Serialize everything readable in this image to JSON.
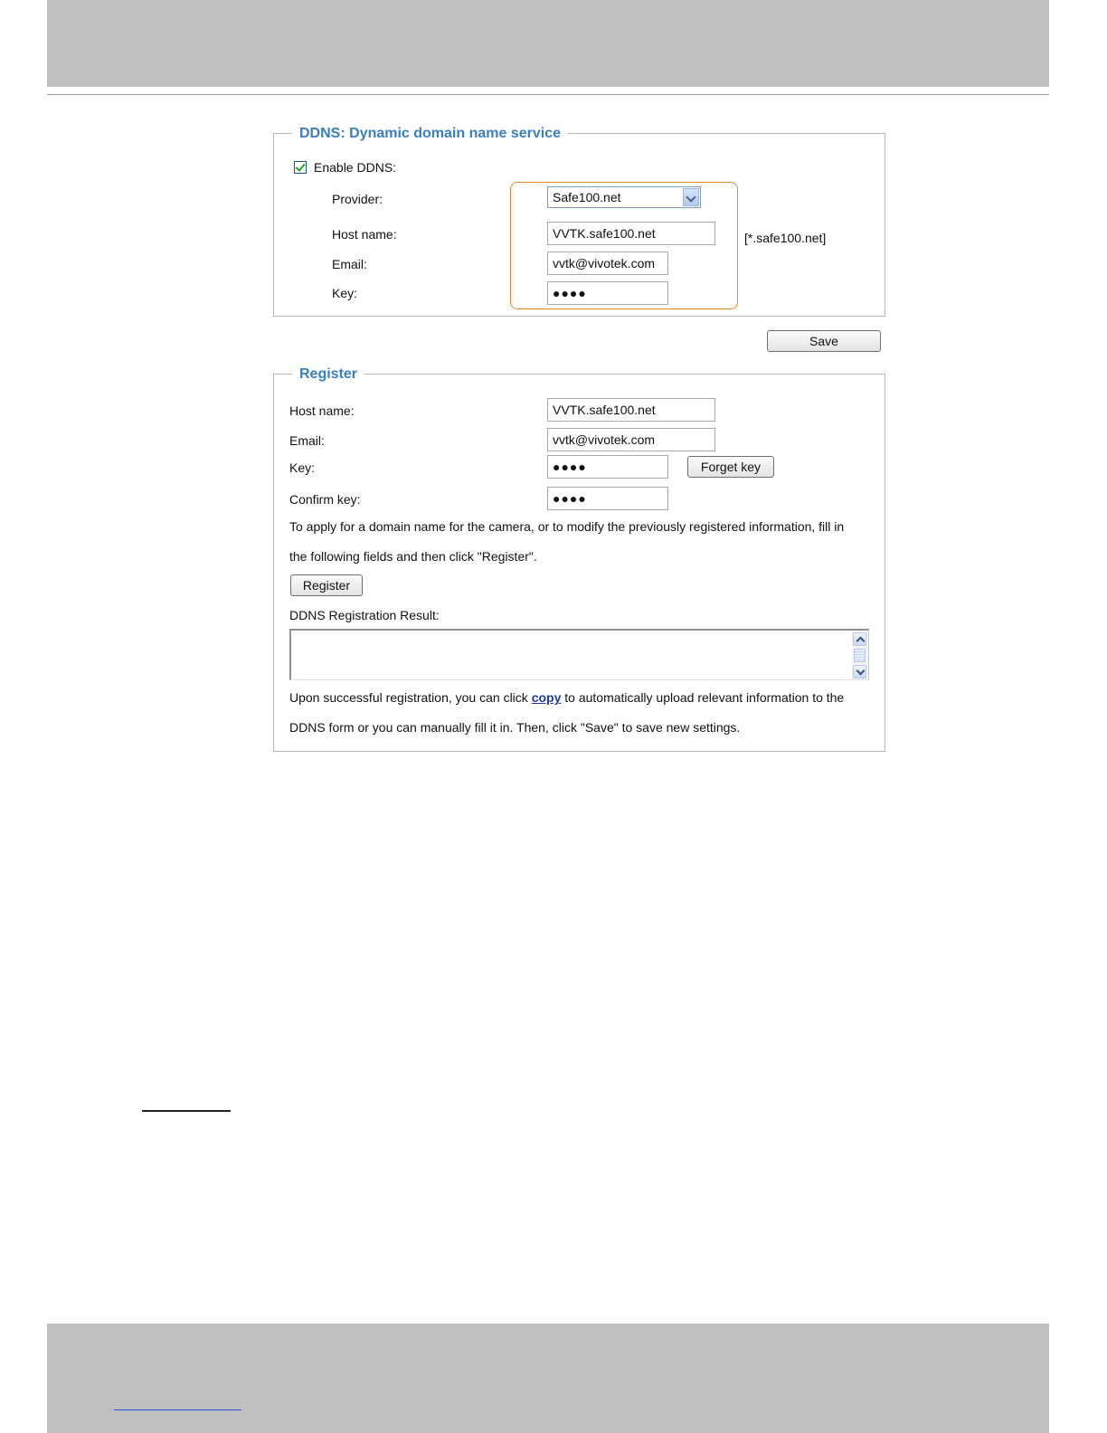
{
  "ddns": {
    "legend": "DDNS: Dynamic domain name service",
    "enable_label": "Enable DDNS:",
    "enable_checked": true,
    "provider_label": "Provider:",
    "provider_value": "Safe100.net",
    "hostname_label": "Host name:",
    "hostname_value": "VVTK.safe100.net",
    "hostname_suffix": "[*.safe100.net]",
    "email_label": "Email:",
    "email_value": "vvtk@vivotek.com",
    "key_label": "Key:",
    "key_value": "●●●●",
    "save_label": "Save"
  },
  "register": {
    "legend": "Register",
    "hostname_label": "Host name:",
    "hostname_value": "VVTK.safe100.net",
    "email_label": "Email:",
    "email_value": "vvtk@vivotek.com",
    "key_label": "Key:",
    "key_value": "●●●●",
    "forget_key_label": "Forget key",
    "confirm_key_label": "Confirm key:",
    "confirm_key_value": "●●●●",
    "instruction_line1": "To apply for a domain name for the camera, or to modify the previously registered information, fill in",
    "instruction_line2": "the following fields and then click \"Register\".",
    "register_label": "Register",
    "result_label": "DDNS Registration Result:",
    "result_value": "",
    "upon_before": "Upon successful registration, you can click ",
    "copy_link": "copy",
    "upon_after": " to automatically upload relevant information to the",
    "upon_line2": "DDNS form or you can manually fill it in. Then, click \"Save\" to save new settings."
  }
}
